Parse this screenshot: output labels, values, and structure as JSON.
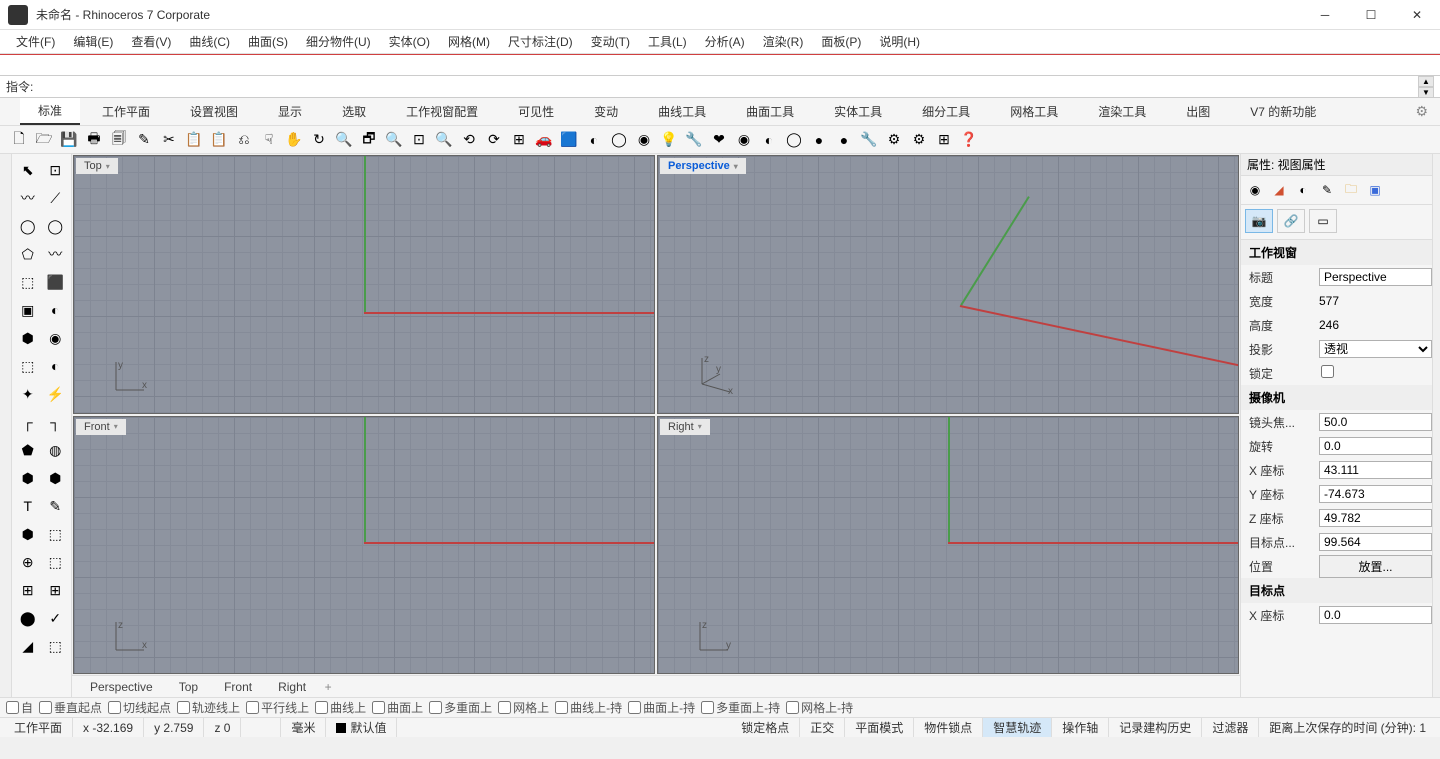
{
  "title": "未命名 - Rhinoceros 7 Corporate",
  "menu": [
    "文件(F)",
    "编辑(E)",
    "查看(V)",
    "曲线(C)",
    "曲面(S)",
    "细分物件(U)",
    "实体(O)",
    "网格(M)",
    "尺寸标注(D)",
    "变动(T)",
    "工具(L)",
    "分析(A)",
    "渲染(R)",
    "面板(P)",
    "说明(H)"
  ],
  "cmd_label": "指令:",
  "tabs": [
    "标准",
    "工作平面",
    "设置视图",
    "显示",
    "选取",
    "工作视窗配置",
    "可见性",
    "变动",
    "曲线工具",
    "曲面工具",
    "实体工具",
    "细分工具",
    "网格工具",
    "渲染工具",
    "出图",
    "V7 的新功能"
  ],
  "viewports": {
    "top": "Top",
    "perspective": "Perspective",
    "front": "Front",
    "right": "Right"
  },
  "vptabs": [
    "Perspective",
    "Top",
    "Front",
    "Right"
  ],
  "panel": {
    "header": "属性: 视图属性",
    "s1": "工作视窗",
    "title_l": "标题",
    "title_v": "Perspective",
    "width_l": "宽度",
    "width_v": "577",
    "height_l": "高度",
    "height_v": "246",
    "proj_l": "投影",
    "proj_v": "透视",
    "lock_l": "锁定",
    "s2": "摄像机",
    "lens_l": "镜头焦...",
    "lens_v": "50.0",
    "rot_l": "旋转",
    "rot_v": "0.0",
    "cx_l": "X 座标",
    "cx_v": "43.111",
    "cy_l": "Y 座标",
    "cy_v": "-74.673",
    "cz_l": "Z 座标",
    "cz_v": "49.782",
    "tgtd_l": "目标点...",
    "tgtd_v": "99.564",
    "pos_l": "位置",
    "pos_btn": "放置...",
    "s3": "目标点",
    "tx_l": "X 座标",
    "tx_v": "0.0"
  },
  "osnap": [
    "自",
    "垂直起点",
    "切线起点",
    "轨迹线上",
    "平行线上",
    "曲线上",
    "曲面上",
    "多重面上",
    "网格上",
    "曲线上-持",
    "曲面上-持",
    "多重面上-持",
    "网格上-持"
  ],
  "status": {
    "cplane": "工作平面",
    "x": "x -32.169",
    "y": "y 2.759",
    "z": "z 0",
    "units": "毫米",
    "layer": "默认值",
    "toggles": [
      "锁定格点",
      "正交",
      "平面模式",
      "物件锁点",
      "智慧轨迹",
      "操作轴",
      "记录建构历史",
      "过滤器"
    ],
    "time": "距离上次保存的时间 (分钟): 1"
  }
}
